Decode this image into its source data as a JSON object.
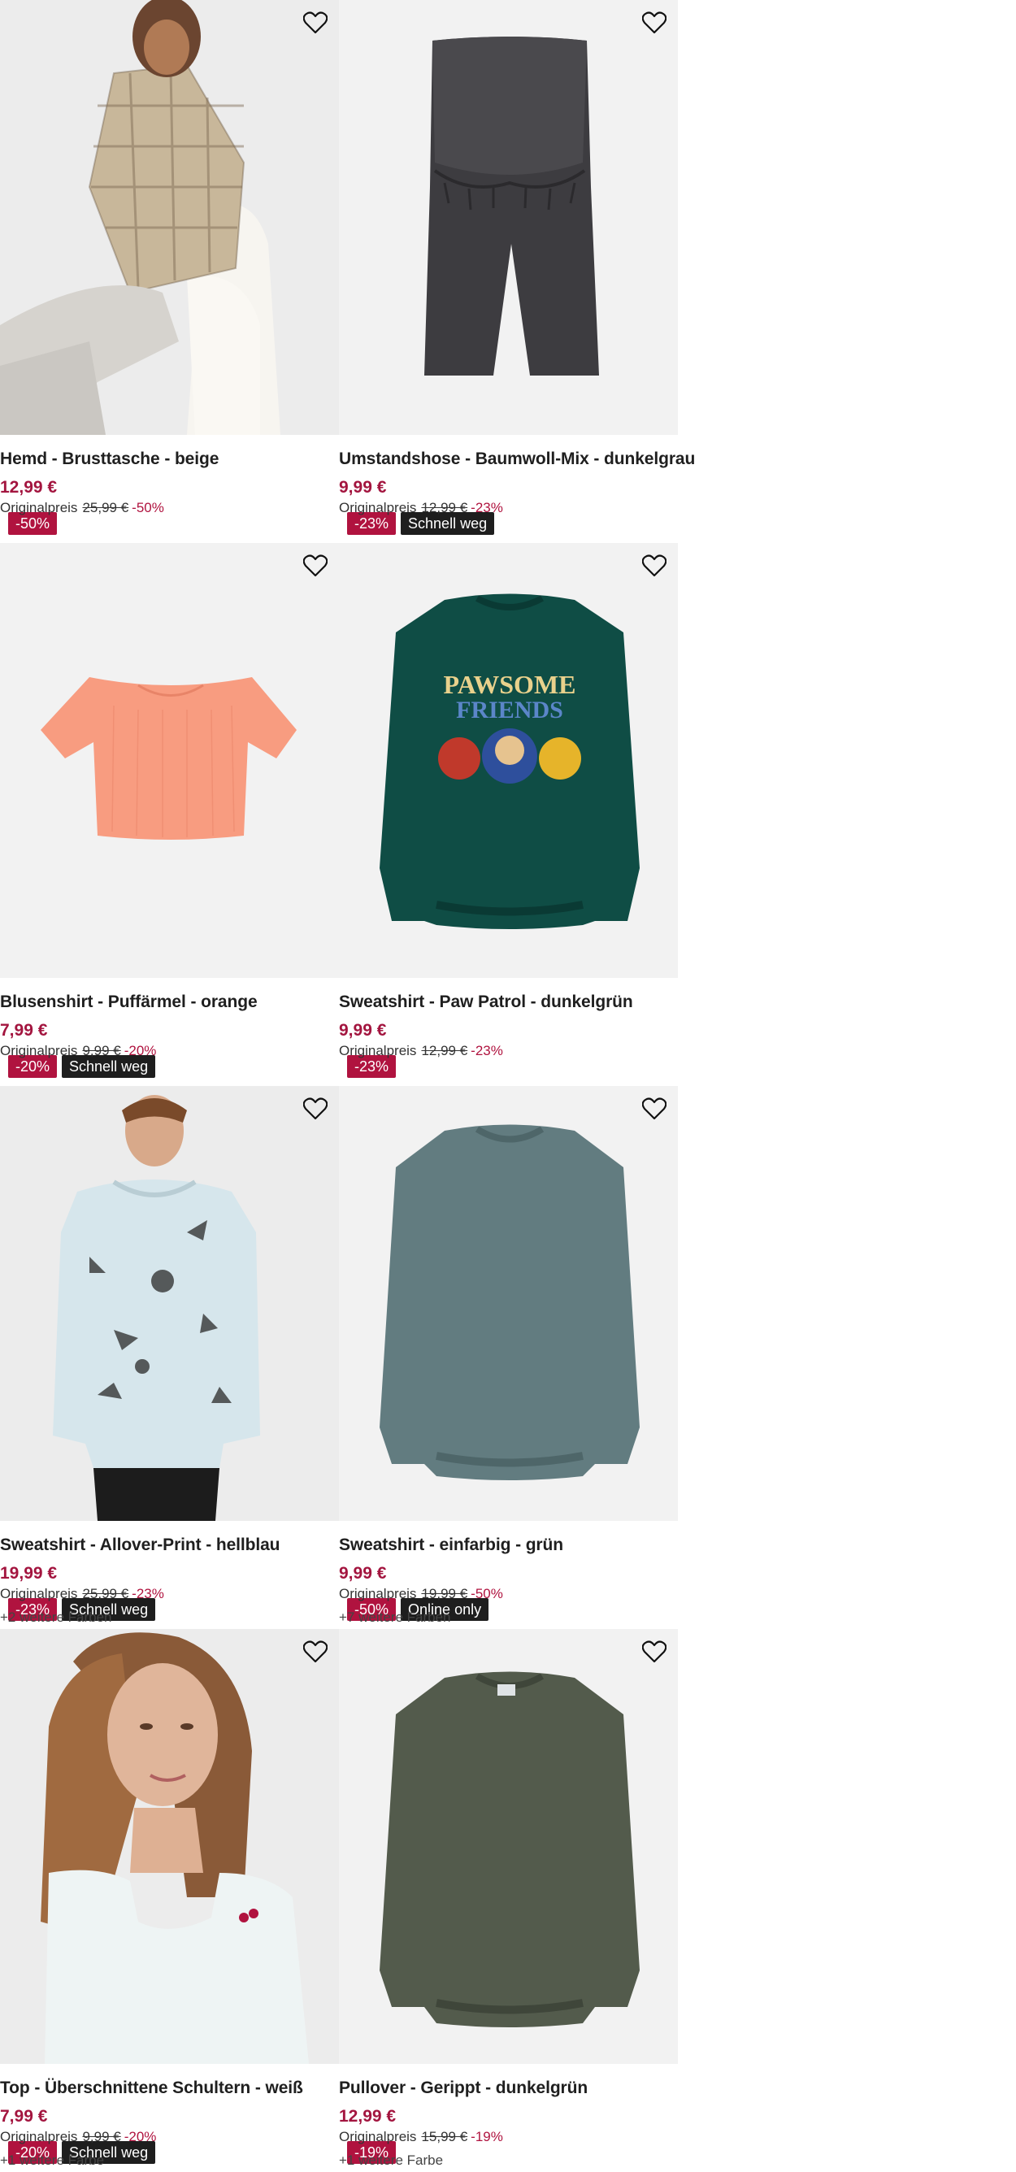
{
  "products": [
    {
      "title": "Hemd - Brusttasche - beige",
      "price": "12,99 €",
      "orig_label": "Originalpreis",
      "orig_price": "25,99 €",
      "orig_pct": "-50%",
      "badge_sale": "-50%",
      "badge_tag": "",
      "colors": "",
      "image": "shirt-model"
    },
    {
      "title": "Umstandshose - Baumwoll-Mix - dunkelgrau",
      "price": "9,99 €",
      "orig_label": "Originalpreis",
      "orig_price": "12,99 €",
      "orig_pct": "-23%",
      "badge_sale": "-23%",
      "badge_tag": "Schnell weg",
      "colors": "",
      "image": "shorts"
    },
    {
      "title": "Blusenshirt - Puffärmel - orange",
      "price": "7,99 €",
      "orig_label": "Originalpreis",
      "orig_price": "9,99 €",
      "orig_pct": "-20%",
      "badge_sale": "-20%",
      "badge_tag": "Schnell weg",
      "colors": "",
      "image": "crop-top"
    },
    {
      "title": "Sweatshirt - Paw Patrol - dunkelgrün",
      "price": "9,99 €",
      "orig_label": "Originalpreis",
      "orig_price": "12,99 €",
      "orig_pct": "-23%",
      "badge_sale": "-23%",
      "badge_tag": "",
      "colors": "",
      "image": "sweatshirt-print"
    },
    {
      "title": "Sweatshirt - Allover-Print - hellblau",
      "price": "19,99 €",
      "orig_label": "Originalpreis",
      "orig_price": "25,99 €",
      "orig_pct": "-23%",
      "badge_sale": "-23%",
      "badge_tag": "Schnell weg",
      "colors": "+2 weitere Farben",
      "image": "hoodie-model"
    },
    {
      "title": "Sweatshirt - einfarbig - grün",
      "price": "9,99 €",
      "orig_label": "Originalpreis",
      "orig_price": "19,99 €",
      "orig_pct": "-50%",
      "badge_sale": "-50%",
      "badge_tag": "Online only",
      "colors": "+7 weitere Farben",
      "image": "sweatshirt-plain"
    },
    {
      "title": "Top - Überschnittene Schultern - weiß",
      "price": "7,99 €",
      "orig_label": "Originalpreis",
      "orig_price": "9,99 €",
      "orig_pct": "-20%",
      "badge_sale": "-20%",
      "badge_tag": "Schnell weg",
      "colors": "+1 weitere Farbe",
      "image": "tank-model"
    },
    {
      "title": "Pullover - Gerippt - dunkelgrün",
      "price": "12,99 €",
      "orig_label": "Originalpreis",
      "orig_price": "15,99 €",
      "orig_pct": "-19%",
      "badge_sale": "-19%",
      "badge_tag": "",
      "colors": "+1 weitere Farbe",
      "image": "pullover"
    }
  ],
  "print_text": {
    "line1": "PAWSOME",
    "line2": "FRIENDS"
  },
  "icons": {
    "favorite": "heart-outline-icon"
  },
  "colors": {
    "sale": "#b0133f",
    "price": "#a3153f",
    "tag_bg": "#1e1e1e",
    "image_bg": "#f2f2f2"
  }
}
